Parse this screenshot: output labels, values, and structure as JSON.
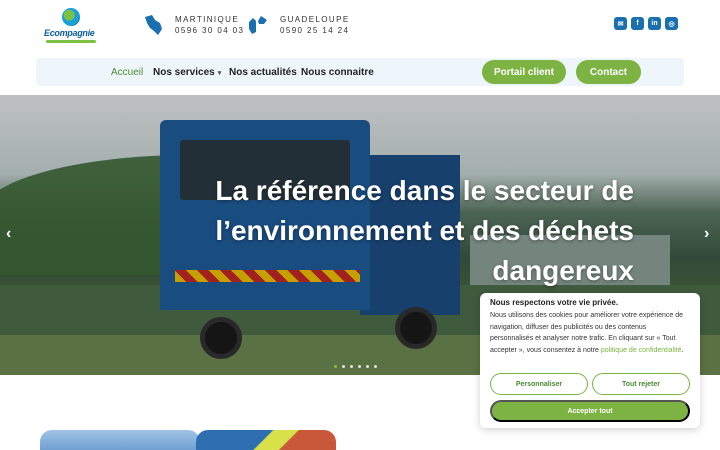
{
  "brand": {
    "name": "Ecompagnie"
  },
  "contacts": [
    {
      "region": "MARTINIQUE",
      "phone": "0596 30 04 03"
    },
    {
      "region": "GUADELOUPE",
      "phone": "0590 25 14 24"
    }
  ],
  "socials": [
    {
      "icon": "mail-icon",
      "glyph": "✉"
    },
    {
      "icon": "facebook-icon",
      "glyph": "f"
    },
    {
      "icon": "linkedin-icon",
      "glyph": "in"
    },
    {
      "icon": "instagram-icon",
      "glyph": "◎"
    }
  ],
  "nav": {
    "home": "Accueil",
    "services": "Nos services",
    "news": "Nos actualités",
    "about": "Nous connaitre",
    "portal": "Portail client",
    "contact": "Contact"
  },
  "hero": {
    "title": "La référence dans le secteur de l’environnement et des déchets dangereux",
    "slide_count": 6,
    "active_slide": 1
  },
  "cookie": {
    "title": "Nous respectons votre vie privée.",
    "text": "Nous utilisons des cookies pour améliorer votre expérience de navigation, diffuser des publicités ou des contenus personnalisés et analyser notre trafic. En cliquant sur « Tout accepter », vous consentez à notre ",
    "link": "politique de confidentialité",
    "text_end": ".",
    "customize": "Personnaliser",
    "reject": "Tout rejeter",
    "accept": "Accepter tout"
  },
  "colors": {
    "accent": "#7cb342",
    "brand_blue": "#1a6fae",
    "nav_bg": "#eef6fb"
  }
}
